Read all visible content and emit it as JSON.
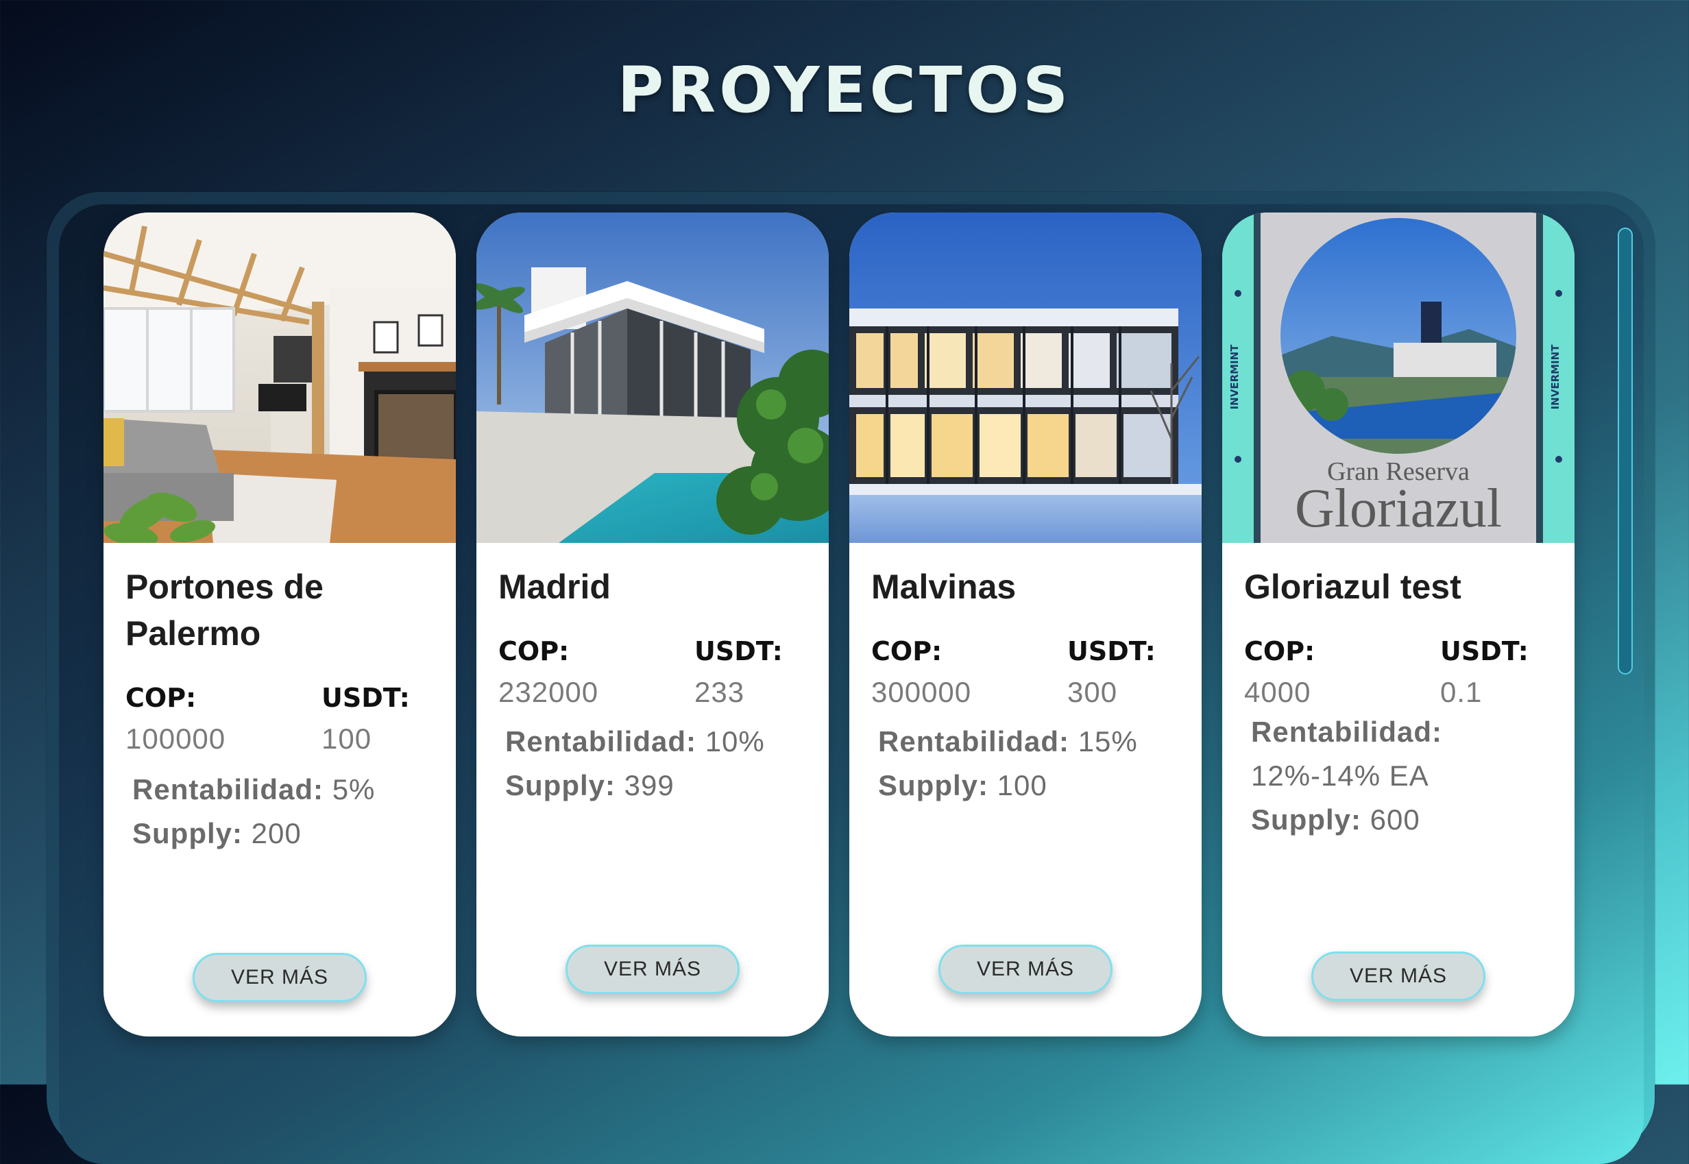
{
  "page": {
    "title": "PROYECTOS"
  },
  "projects": [
    {
      "name": "Portones de Palermo",
      "cop_label": "COP:",
      "cop_value": "100000",
      "usdt_label": "USDT:",
      "usdt_value": "100",
      "rent_label": "Rentabilidad:",
      "rent_value": "5%",
      "supply_label": "Supply:",
      "supply_value": "200",
      "button_label": "VER MÁS",
      "image_icon": "living-room-photo"
    },
    {
      "name": "Madrid",
      "cop_label": "COP:",
      "cop_value": "232000",
      "usdt_label": "USDT:",
      "usdt_value": "233",
      "rent_label": "Rentabilidad:",
      "rent_value": "10%",
      "supply_label": "Supply:",
      "supply_value": "399",
      "button_label": "VER MÁS",
      "image_icon": "modern-house-pool-photo"
    },
    {
      "name": "Malvinas",
      "cop_label": "COP:",
      "cop_value": "300000",
      "usdt_label": "USDT:",
      "usdt_value": "300",
      "rent_label": "Rentabilidad:",
      "rent_value": "15%",
      "supply_label": "Supply:",
      "supply_value": "100",
      "button_label": "VER MÁS",
      "image_icon": "glass-house-night-photo"
    },
    {
      "name": "Gloriazul test",
      "cop_label": "COP:",
      "cop_value": "4000",
      "usdt_label": "USDT:",
      "usdt_value": "0.1",
      "rent_label": "Rentabilidad:",
      "rent_value": "12%-14% EA",
      "supply_label": "Supply:",
      "supply_value": "600",
      "button_label": "VER MÁS",
      "image_icon": "gloriazul-logo",
      "logo_text_top": "Gran Reserva",
      "logo_text_main": "Gloriazul",
      "logo_side_text": "INVERMINT"
    }
  ],
  "colors": {
    "accent": "#7fe0ee",
    "button_bg": "#d3dcdc",
    "card_bg": "#ffffff"
  }
}
